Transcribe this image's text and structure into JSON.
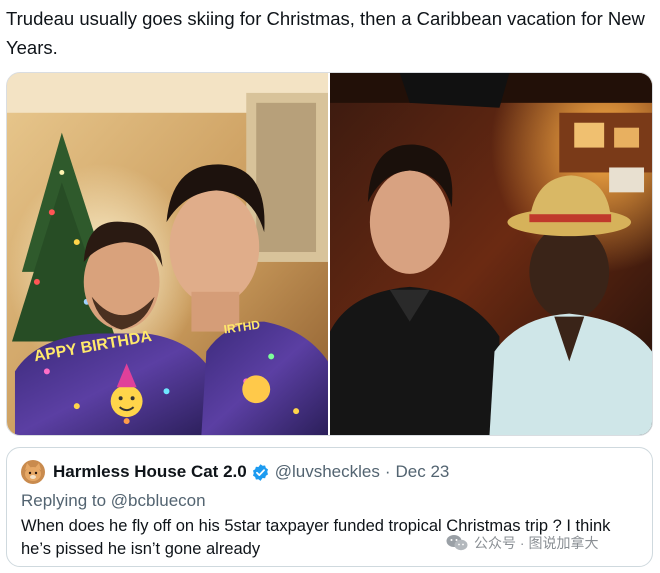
{
  "tweet": {
    "text": "Trudeau usually goes skiing for Christmas, then a Caribbean vacation for New Years."
  },
  "media": {
    "left_photo": {
      "sweater_text_1": "APPY BIRTHDA",
      "sweater_text_2": "IRTHD"
    },
    "right_photo": {}
  },
  "quoted_tweet": {
    "display_name": "Harmless House Cat 2.0",
    "verified_icon": "verified-badge-icon",
    "handle": "@luvsheckles",
    "separator": "·",
    "date": "Dec 23",
    "replying_to_label": "Replying to",
    "replying_to_handle": "@bcbluecon",
    "text": "When does he fly off on his 5star taxpayer funded tropical Christmas trip ? I think he’s pissed he isn’t gone already"
  },
  "watermark": {
    "text": "公众号 · 图说加拿大",
    "icon": "wechat-icon"
  },
  "colors": {
    "text_primary": "#0f1419",
    "text_secondary": "#536471",
    "verified_blue": "#1d9bf0",
    "border": "#cfd9de"
  }
}
